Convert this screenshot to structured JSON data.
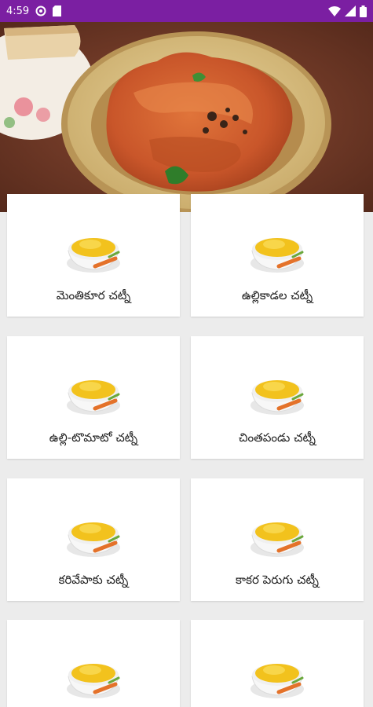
{
  "status_bar": {
    "time": "4:59",
    "left_icons": [
      "sync-icon",
      "sd-card-icon"
    ],
    "right_icons": [
      "wifi-icon",
      "cell-signal-icon",
      "battery-icon"
    ],
    "color": "#7b1fa2"
  },
  "hero": {
    "image": "chutney-bowl-photo"
  },
  "recipes": [
    {
      "title": "మెంతికూర చట్నీ",
      "icon": "chutney-bowl-icon"
    },
    {
      "title": "ఉల్లికాడల చట్నీ",
      "icon": "chutney-bowl-icon"
    },
    {
      "title": "ఉల్లి-టొమాటో చట్నీ",
      "icon": "chutney-bowl-icon"
    },
    {
      "title": "చింతపండు చట్నీ",
      "icon": "chutney-bowl-icon"
    },
    {
      "title": "కరివేపాకు చట్నీ",
      "icon": "chutney-bowl-icon"
    },
    {
      "title": "కాకర పెరుగు చట్నీ",
      "icon": "chutney-bowl-icon"
    },
    {
      "title": "",
      "icon": "chutney-bowl-icon"
    },
    {
      "title": "",
      "icon": "chutney-bowl-icon"
    }
  ]
}
